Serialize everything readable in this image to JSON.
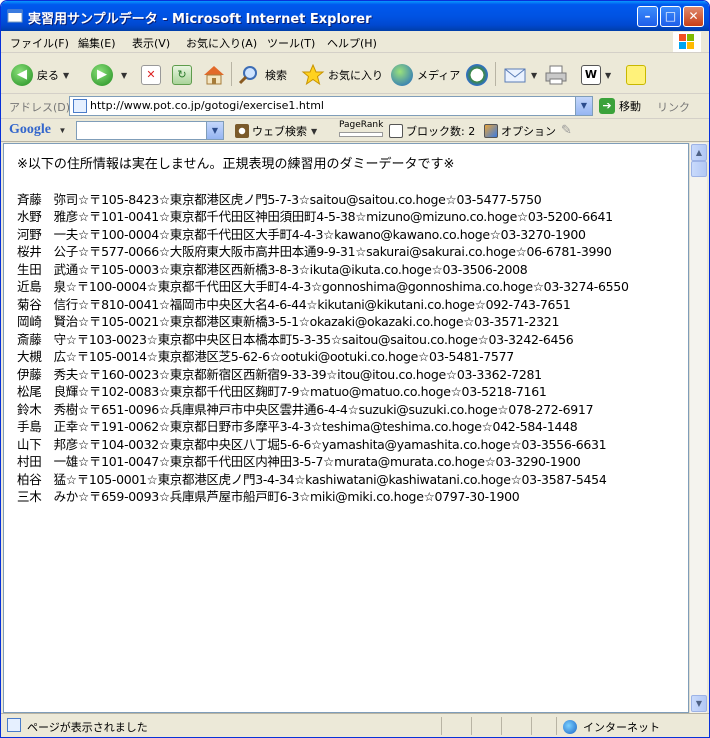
{
  "window": {
    "title": "実習用サンプルデータ - Microsoft Internet Explorer",
    "buttons": {
      "minimize": "–",
      "maximize": "□",
      "close": "✕"
    }
  },
  "menu": [
    "ファイル(F)",
    "編集(E)",
    "表示(V)",
    "お気に入り(A)",
    "ツール(T)",
    "ヘルプ(H)"
  ],
  "toolbar": {
    "back": "戻る",
    "search": "検索",
    "favorites": "お気に入り",
    "media": "メディア"
  },
  "address": {
    "label": "アドレス(D)",
    "url": "http://www.pot.co.jp/gotogi/exercise1.html",
    "go": "移動",
    "links": "リンク"
  },
  "google": {
    "logo": "Google",
    "web_search": "ウェブ検索",
    "pagerank": "PageRank",
    "blocked": "ブロック数: 2",
    "options": "オプション"
  },
  "page": {
    "notice": "※以下の住所情報は実在しません。正規表現の練習用のダミーデータです※",
    "entries": [
      "斉藤　弥司☆〒105-8423☆東京都港区虎ノ門5-7-3☆saitou@saitou.co.hoge☆03-5477-5750",
      "水野　雅彦☆〒101-0041☆東京都千代田区神田須田町4-5-38☆mizuno@mizuno.co.hoge☆03-5200-6641",
      "河野　一夫☆〒100-0004☆東京都千代田区大手町4-4-3☆kawano@kawano.co.hoge☆03-3270-1900",
      "桜井　公子☆〒577-0066☆大阪府東大阪市高井田本通9-9-31☆sakurai@sakurai.co.hoge☆06-6781-3990",
      "生田　武通☆〒105-0003☆東京都港区西新橋3-8-3☆ikuta@ikuta.co.hoge☆03-3506-2008",
      "近島　泉☆〒100-0004☆東京都千代田区大手町4-4-3☆gonnoshima@gonnoshima.co.hoge☆03-3274-6550",
      "菊谷　信行☆〒810-0041☆福岡市中央区大名4-6-44☆kikutani@kikutani.co.hoge☆092-743-7651",
      "岡崎　賢治☆〒105-0021☆東京都港区東新橋3-5-1☆okazaki@okazaki.co.hoge☆03-3571-2321",
      "斎藤　守☆〒103-0023☆東京都中央区日本橋本町5-3-35☆saitou@saitou.co.hoge☆03-3242-6456",
      "大槻　広☆〒105-0014☆東京都港区芝5-62-6☆ootuki@ootuki.co.hoge☆03-5481-7577",
      "伊藤　秀夫☆〒160-0023☆東京都新宿区西新宿9-33-39☆itou@itou.co.hoge☆03-3362-7281",
      "松尾　良輝☆〒102-0083☆東京都千代田区麹町7-9☆matuo@matuo.co.hoge☆03-5218-7161",
      "鈴木　秀樹☆〒651-0096☆兵庫県神戸市中央区雲井通6-4-4☆suzuki@suzuki.co.hoge☆078-272-6917",
      "手島　正幸☆〒191-0062☆東京都日野市多摩平3-4-3☆teshima@teshima.co.hoge☆042-584-1448",
      "山下　邦彦☆〒104-0032☆東京都中央区八丁堀5-6-6☆yamashita@yamashita.co.hoge☆03-3556-6631",
      "村田　一雄☆〒101-0047☆東京都千代田区内神田3-5-7☆murata@murata.co.hoge☆03-3290-1900",
      "柏谷　猛☆〒105-0001☆東京都港区虎ノ門3-4-34☆kashiwatani@kashiwatani.co.hoge☆03-3587-5454",
      "三木　みか☆〒659-0093☆兵庫県芦屋市船戸町6-3☆miki@miki.co.hoge☆0797-30-1900"
    ]
  },
  "status": {
    "text": "ページが表示されました",
    "zone": "インターネット"
  }
}
